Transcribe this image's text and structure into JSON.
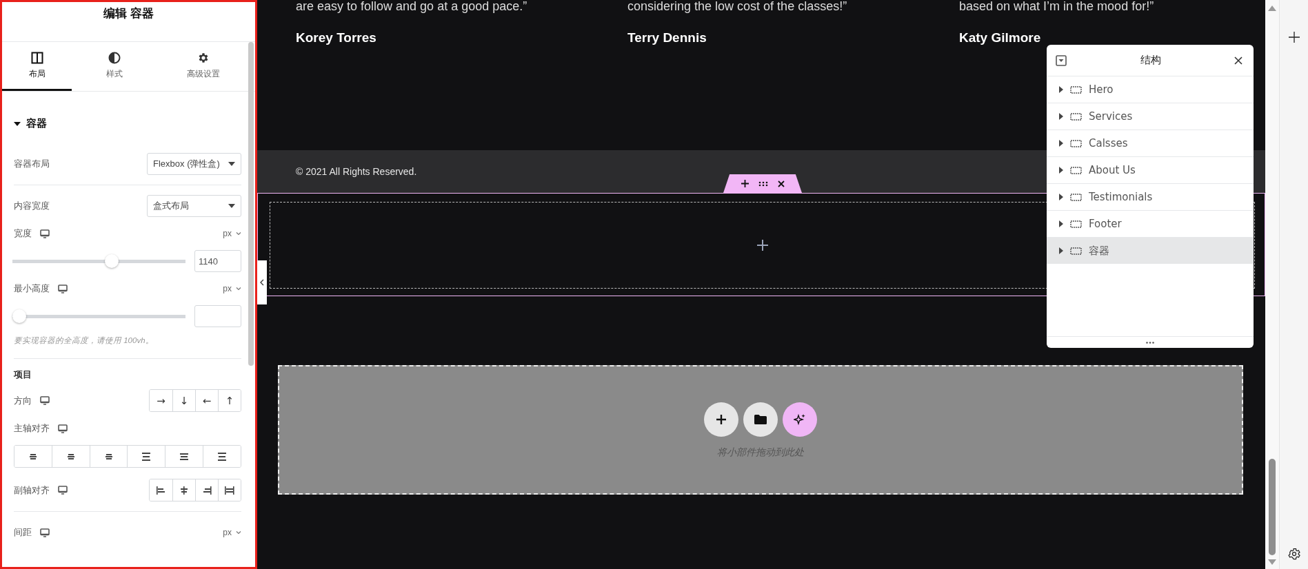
{
  "panel": {
    "title": "编辑 容器",
    "tabs": [
      {
        "label": "布局",
        "selected": true
      },
      {
        "label": "样式",
        "selected": false
      },
      {
        "label": "高级设置",
        "selected": false
      }
    ],
    "section": {
      "title": "容器",
      "expanded": true
    },
    "controls": [
      {
        "kind": "select",
        "label": "容器布局",
        "value": "Flexbox (弹性盒)"
      },
      {
        "kind": "divider"
      },
      {
        "kind": "select",
        "label": "内容宽度",
        "value": "盒式布局"
      },
      {
        "kind": "slider",
        "label": "宽度",
        "responsive": true,
        "unit": "px",
        "level": 0.58,
        "value": "1140"
      },
      {
        "kind": "slider",
        "label": "最小高度",
        "responsive": true,
        "unit": "px",
        "level": 0
      },
      {
        "kind": "hint",
        "text": "要实现容器的全高度，请使用 100vh。"
      },
      {
        "kind": "divider"
      },
      {
        "kind": "heading",
        "text": "项目"
      },
      {
        "kind": "arrows",
        "label": "方向",
        "responsive": true,
        "options": [
          "→",
          "↓",
          "←",
          "↑"
        ]
      },
      {
        "kind": "justify",
        "label": "主轴对齐",
        "responsive": true
      },
      {
        "kind": "align",
        "label": "副轴对齐",
        "responsive": true
      },
      {
        "kind": "divider"
      },
      {
        "kind": "unit",
        "label": "间距",
        "responsive": true,
        "unit": "px"
      }
    ]
  },
  "canvas": {
    "testimonials": [
      {
        "quote": "are easy to follow and go at a good pace.”",
        "name": "Korey Torres"
      },
      {
        "quote": "considering the low cost of the classes!”",
        "name": "Terry Dennis"
      },
      {
        "quote": "based on what I’m in the mood for!”",
        "name": "Katy Gilmore"
      }
    ],
    "footer": "© 2021 All Rights Reserved.",
    "drop_hint": "将小部件拖动到此处"
  },
  "navigator": {
    "title": "结构",
    "items": [
      {
        "label": "Hero",
        "selected": false
      },
      {
        "label": "Services",
        "selected": false
      },
      {
        "label": "Calsses",
        "selected": false
      },
      {
        "label": "About Us",
        "selected": false
      },
      {
        "label": "Testimonials",
        "selected": false
      },
      {
        "label": "Footer",
        "selected": false
      },
      {
        "label": "容器",
        "selected": true
      }
    ]
  }
}
